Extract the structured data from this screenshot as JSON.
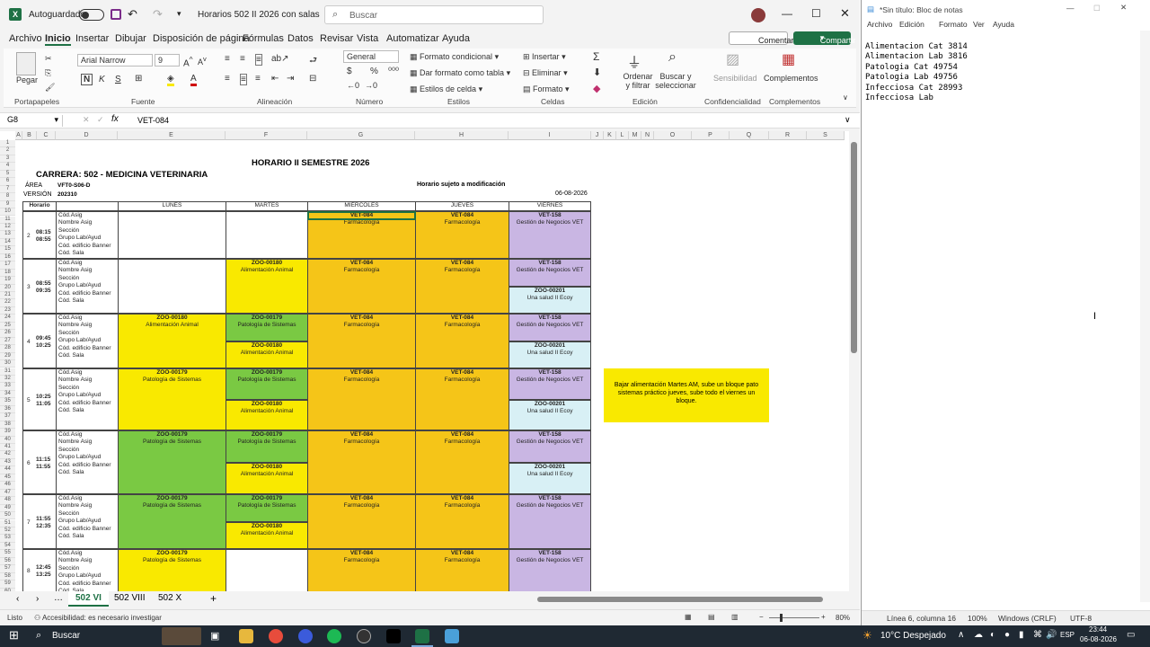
{
  "excel": {
    "autosave_label": "Autoguardado",
    "doc_title": "Horarios 502 II 2026 con salas",
    "search_placeholder": "Buscar",
    "ribbon_tabs": [
      "Archivo",
      "Inicio",
      "Insertar",
      "Dibujar",
      "Disposición de página",
      "Fórmulas",
      "Datos",
      "Revisar",
      "Vista",
      "Automatizar",
      "Ayuda"
    ],
    "comments_label": "Comentarios",
    "share_label": "Compartir",
    "ribbon": {
      "paste_label": "Pegar",
      "clipboard_group": "Portapapeles",
      "font_name": "Arial Narrow",
      "font_size": "9",
      "font_group": "Fuente",
      "align_group": "Alineación",
      "number_format": "General",
      "number_group": "Número",
      "cond_format": "Formato condicional",
      "format_table": "Dar formato como tabla",
      "cell_styles": "Estilos de celda",
      "styles_group": "Estilos",
      "insert": "Insertar",
      "delete": "Eliminar",
      "format": "Formato",
      "cells_group": "Celdas",
      "sort_filter": "Ordenar y filtrar",
      "find_select": "Buscar y seleccionar",
      "editing_group": "Edición",
      "sensitivity": "Sensibilidad",
      "confidentiality_group": "Confidencialidad",
      "addins": "Complementos",
      "addins_group": "Complementos"
    },
    "name_box": "G8",
    "formula_value": "VET-084",
    "columns": [
      "A",
      "B",
      "C",
      "D",
      "E",
      "F",
      "G",
      "H",
      "I",
      "J",
      "K",
      "L",
      "M",
      "N",
      "O",
      "P",
      "Q",
      "R",
      "S"
    ],
    "sheet": {
      "title": "HORARIO II SEMESTRE 2026",
      "career": "CARRERA: 502 - MEDICINA VETERINARIA",
      "area_label": "ÁREA",
      "area_value": "VFT0-S06-D",
      "version_label": "VERSIÓN",
      "version_value": "202310",
      "notice": "Horario sujeto a modificación",
      "date": "06-08-2026",
      "headers": [
        "Horario",
        "LUNES",
        "MARTES",
        "MIÉRCOLES",
        "JUEVES",
        "VIERNES"
      ],
      "row_fields": [
        "Cód.Asig",
        "Nombre Asig",
        "Sección",
        "Grupo Lab/Ayud",
        "Cód. edificio Banner",
        "Cód. Sala"
      ],
      "blocks": [
        {
          "n": "2",
          "time": "08:15\n08:55"
        },
        {
          "n": "3",
          "time": "08:55\n09:35"
        },
        {
          "n": "4",
          "time": "09:45\n10:25"
        },
        {
          "n": "5",
          "time": "10:25\n11:05"
        },
        {
          "n": "6",
          "time": "11:15\n11:55"
        },
        {
          "n": "7",
          "time": "11:55\n12:35"
        },
        {
          "n": "8",
          "time": "12:45\n13:25"
        }
      ],
      "courses": {
        "vet084": "VET-084",
        "vet084_name": "Farmacología",
        "vet158": "VET-158",
        "vet158_name": "Gestión de Negocios VET",
        "zoo180": "ZOO-00180",
        "zoo180_name": "Alimentación Animal",
        "zoo179": "ZOO-00179",
        "zoo179_name": "Patología de Sistemas",
        "zoo201": "ZOO-00201",
        "zoo201_name": "Una salud II Ecoy"
      },
      "note": "Bajar alimentación Martes AM, sube un bloque pato sistemas práctico jueves, sube todo el viernes un bloque."
    },
    "sheet_tabs": [
      "502 VI",
      "502 VIII",
      "502 X"
    ],
    "status_ready": "Listo",
    "status_access": "Accesibilidad: es necesario investigar",
    "zoom": "80%"
  },
  "notepad": {
    "title": "*Sin título: Bloc de notas",
    "menu": [
      "Archivo",
      "Edición",
      "Formato",
      "Ver",
      "Ayuda"
    ],
    "lines": [
      "Alimentacion Cat 3814",
      "Alimentacion Lab 3816",
      "Patologia Cat 49754",
      "Patologia Lab 49756",
      "Infecciosa Cat 28993",
      "Infecciosa Lab"
    ],
    "status_pos": "Línea 6, columna 16",
    "status_zoom": "100%",
    "status_eol": "Windows (CRLF)",
    "status_enc": "UTF-8"
  },
  "taskbar": {
    "search": "Buscar",
    "weather": "10°C  Despejado",
    "lang": "ESP",
    "time": "23:44",
    "date": "06-08-2026"
  },
  "colors": {
    "yellow": "#f9e900",
    "gold": "#f5c518",
    "green": "#7ac943",
    "lilac": "#c9b6e3",
    "cyan": "#d8f0f5",
    "excel_green": "#1e7145"
  }
}
